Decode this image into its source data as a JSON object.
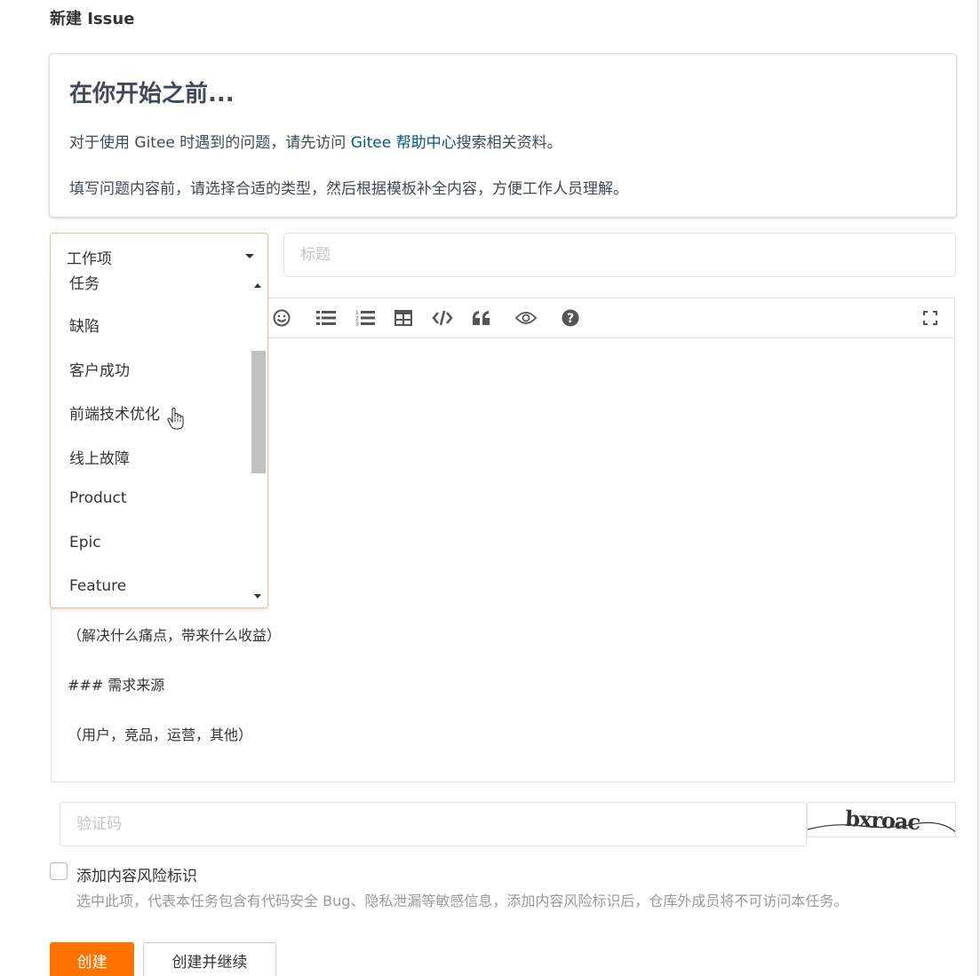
{
  "page": {
    "title": "新建 Issue"
  },
  "notice": {
    "heading": "在你开始之前...",
    "line1_prefix": "对于使用 Gitee 时遇到的问题，请先访问 ",
    "line1_link": "Gitee 帮助中心",
    "line1_suffix": "搜索相关资料。",
    "line2": "填写问题内容前，请选择合适的类型，然后根据模板补全内容，方便工作人员理解。"
  },
  "type_select": {
    "selected": "工作项",
    "options": [
      "任务",
      "缺陷",
      "客户成功",
      "前端技术优化",
      "线上故障",
      "Product",
      "Epic",
      "Feature"
    ]
  },
  "title_input": {
    "placeholder": "标题",
    "value": ""
  },
  "editor": {
    "toolbar_icons": [
      "emoji-icon",
      "unordered-list-icon",
      "ordered-list-icon",
      "table-icon",
      "code-icon",
      "quote-icon",
      "preview-icon",
      "help-icon",
      "fullscreen-icon"
    ],
    "content": [
      "（解决什么痛点，带来什么收益）",
      "### 需求来源",
      "（用户，竞品，运营，其他）"
    ]
  },
  "captcha": {
    "placeholder": "验证码",
    "value": "",
    "image_text": "bxroac"
  },
  "risk": {
    "label": "添加内容风险标识",
    "description": "选中此项，代表本任务包含有代码安全 Bug、隐私泄漏等敏感信息，添加内容风险标识后，仓库外成员将不可访问本任务。",
    "checked": false
  },
  "buttons": {
    "create": "创建",
    "create_continue": "创建并继续"
  },
  "colors": {
    "primary": "#fe7300",
    "link": "#005980",
    "focus_border": "#f5b98a"
  }
}
